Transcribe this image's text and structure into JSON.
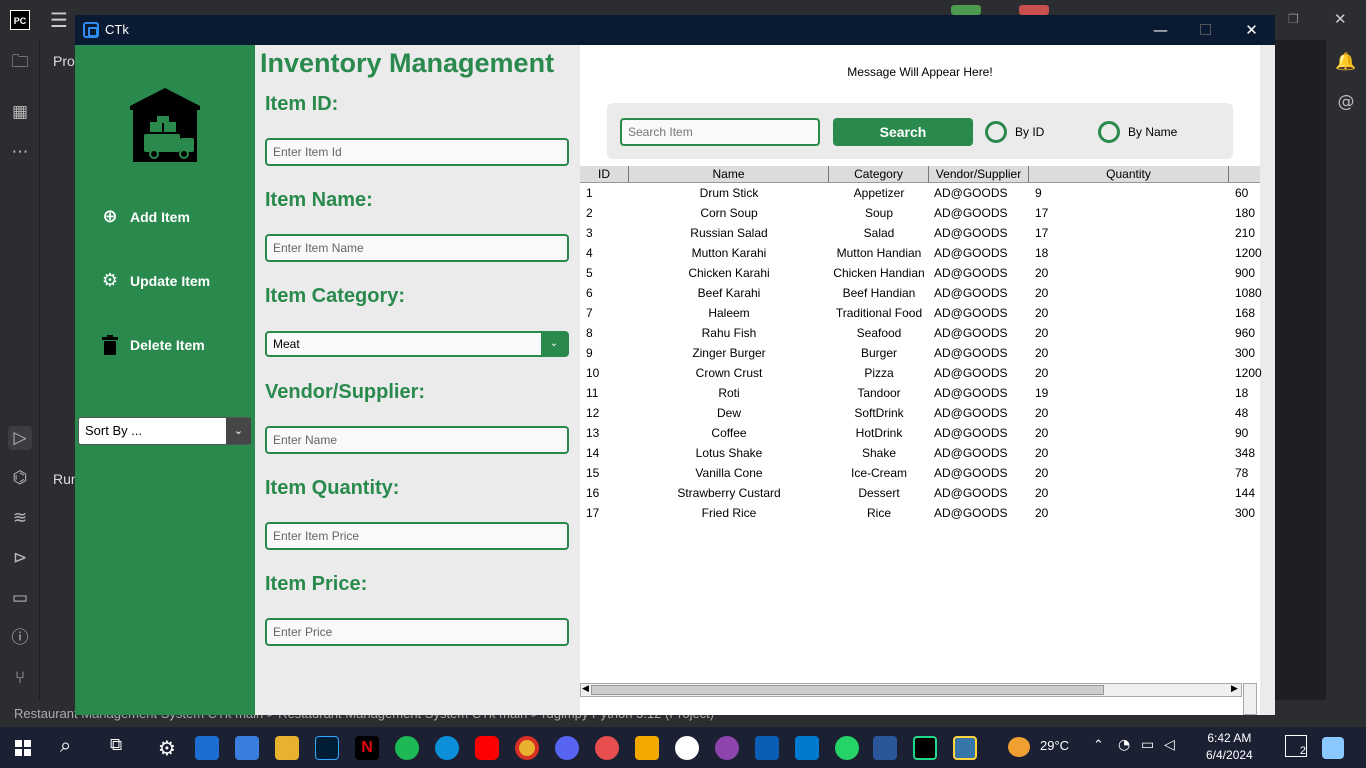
{
  "window": {
    "title": "CTk",
    "minimize": "—",
    "maximize": "☐",
    "close": "✕"
  },
  "ide": {
    "project_label": "Pro",
    "run_label": "Run",
    "status_text": "Restaurant Management System CTk main  >  Restaurant Management System CTk main  >  rdgimpy                                                                                                                                                 Python 3.12 (Project)"
  },
  "sidebar": {
    "add": "Add Item",
    "update": "Update Item",
    "delete": "Delete Item",
    "sort_placeholder": "Sort By ..."
  },
  "form": {
    "title": "Inventory Management",
    "id_label": "Item ID:",
    "id_placeholder": "Enter Item Id",
    "name_label": "Item Name:",
    "name_placeholder": "Enter Item Name",
    "category_label": "Item Category:",
    "category_value": "Meat",
    "vendor_label": "Vendor/Supplier:",
    "vendor_placeholder": "Enter Name",
    "quantity_label": "Item Quantity:",
    "quantity_placeholder": "Enter Item Price",
    "price_label": "Item Price:",
    "price_placeholder": "Enter Price"
  },
  "right": {
    "message": "Message Will Appear Here!",
    "search_placeholder": "Search Item",
    "search_button": "Search",
    "radio_id": "By ID",
    "radio_name": "By Name"
  },
  "table": {
    "columns": [
      "ID",
      "Name",
      "Category",
      "Vendor/Supplier",
      "Quantity"
    ],
    "rows": [
      [
        "1",
        "Drum Stick",
        "Appetizer",
        "AD@GOODS",
        "9",
        "60"
      ],
      [
        "2",
        "Corn Soup",
        "Soup",
        "AD@GOODS",
        "17",
        "180"
      ],
      [
        "3",
        "Russian Salad",
        "Salad",
        "AD@GOODS",
        "17",
        "210"
      ],
      [
        "4",
        "Mutton Karahi",
        "Mutton Handian",
        "AD@GOODS",
        "18",
        "1200"
      ],
      [
        "5",
        "Chicken Karahi",
        "Chicken Handian",
        "AD@GOODS",
        "20",
        "900"
      ],
      [
        "6",
        "Beef Karahi",
        "Beef Handian",
        "AD@GOODS",
        "20",
        "1080"
      ],
      [
        "7",
        "Haleem",
        "Traditional Food",
        "AD@GOODS",
        "20",
        "168"
      ],
      [
        "8",
        "Rahu Fish",
        "Seafood",
        "AD@GOODS",
        "20",
        "960"
      ],
      [
        "9",
        "Zinger Burger",
        "Burger",
        "AD@GOODS",
        "20",
        "300"
      ],
      [
        "10",
        "Crown Crust",
        "Pizza",
        "AD@GOODS",
        "20",
        "1200"
      ],
      [
        "11",
        "Roti",
        "Tandoor",
        "AD@GOODS",
        "19",
        "18"
      ],
      [
        "12",
        "Dew",
        "SoftDrink",
        "AD@GOODS",
        "20",
        "48"
      ],
      [
        "13",
        "Coffee",
        "HotDrink",
        "AD@GOODS",
        "20",
        "90"
      ],
      [
        "14",
        "Lotus Shake",
        "Shake",
        "AD@GOODS",
        "20",
        "348"
      ],
      [
        "15",
        "Vanilla Cone",
        "Ice-Cream",
        "AD@GOODS",
        "20",
        "78"
      ],
      [
        "16",
        "Strawberry Custard",
        "Dessert",
        "AD@GOODS",
        "20",
        "144"
      ],
      [
        "17",
        "Fried Rice",
        "Rice",
        "AD@GOODS",
        "20",
        "300"
      ]
    ]
  },
  "taskbar": {
    "temperature": "29°C",
    "time": "6:42 AM",
    "date": "6/4/2024",
    "notif_count": "2"
  },
  "colors": {
    "accent": "#2a8a4e",
    "titlebar": "#0b1a33",
    "taskbar": "#1b2033"
  }
}
